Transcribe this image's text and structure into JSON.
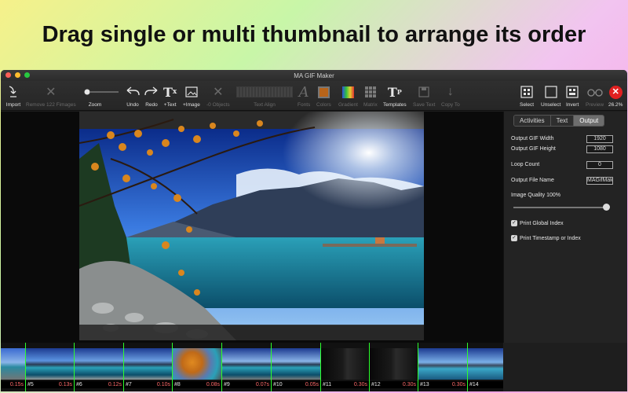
{
  "banner": {
    "text": "Drag single or multi thumbnail to arrange its order"
  },
  "window": {
    "title": "MA GIF Maker"
  },
  "toolbar": {
    "import": "Import",
    "remove": "Remove 122 Fimages",
    "zoom": "Zoom",
    "undo": "Undo",
    "redo": "Redo",
    "add_text": "+Text",
    "add_image": "+Image",
    "objects": "-0 Objects",
    "text_align": "Text Align",
    "fonts": "Fonts",
    "colors": "Colors",
    "gradient": "Gradient",
    "matrix": "Matrix",
    "templates": "Templates",
    "save_text": "Save Text",
    "copy_to": "Copy To",
    "select": "Select",
    "unselect": "Unselect",
    "invert": "Invert",
    "preview": "Preview",
    "zoom_level": "26.2%"
  },
  "panel": {
    "tabs": [
      "Activities",
      "Text",
      "Output"
    ],
    "active_tab": "Output",
    "width_label": "Output GIF Width",
    "width_value": "1920",
    "height_label": "Output GIF Height",
    "height_value": "1080",
    "loop_label": "Loop Count",
    "loop_value": "0",
    "filename_label": "Output File Name",
    "filename_value": "MAGifMak",
    "quality_label": "Image Quality 100%",
    "quality_value": 1.0,
    "print_global": "Print Global Index",
    "print_timestamp": "Print Timestamp or Index"
  },
  "filmstrip": {
    "frames": [
      {
        "index": "",
        "duration": "0.15s"
      },
      {
        "index": "#5",
        "duration": "0.13s"
      },
      {
        "index": "#6",
        "duration": "0.12s"
      },
      {
        "index": "#7",
        "duration": "0.10s"
      },
      {
        "index": "#8",
        "duration": "0.08s"
      },
      {
        "index": "#9",
        "duration": "0.07s"
      },
      {
        "index": "#10",
        "duration": "0.05s"
      },
      {
        "index": "#11",
        "duration": "0.30s"
      },
      {
        "index": "#12",
        "duration": "0.30s"
      },
      {
        "index": "#13",
        "duration": "0.30s"
      },
      {
        "index": "#14",
        "duration": ""
      }
    ]
  },
  "colors": {
    "accent_green": "#2cff2c",
    "duration_red": "#ff6a6a",
    "close_red": "#e02020"
  }
}
